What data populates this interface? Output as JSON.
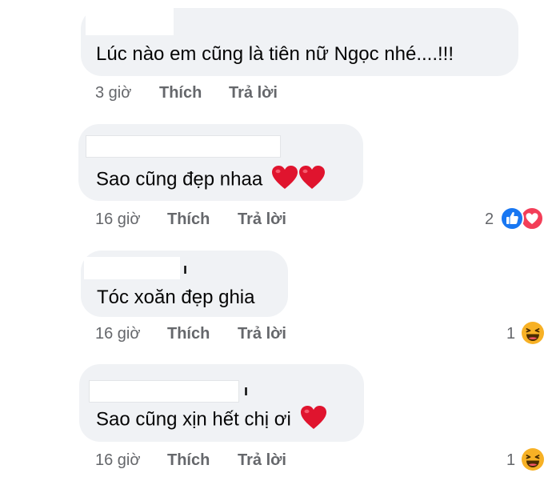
{
  "colors": {
    "bubble": "#f0f2f5",
    "meta_text": "#65676b",
    "text": "#050505",
    "like_blue": "#1877f2",
    "love_red": "#f33e58",
    "haha_yellow": "#f7b125",
    "heart": "#e0142e"
  },
  "comments": [
    {
      "name_fragment": "",
      "text": "Lúc nào em cũng là tiên nữ Ngọc nhé....!!!",
      "hearts": 0,
      "time": "3 giờ",
      "like_label": "Thích",
      "reply_label": "Trả lời",
      "reaction_count": "",
      "reactions": []
    },
    {
      "name_fragment": "",
      "text": "Sao cũng đẹp nhaa",
      "hearts": 2,
      "time": "16 giờ",
      "like_label": "Thích",
      "reply_label": "Trả lời",
      "reaction_count": "2",
      "reactions": [
        "like-icon",
        "love-icon"
      ]
    },
    {
      "name_fragment": "ı",
      "text": "Tóc xoăn đẹp ghia",
      "hearts": 0,
      "time": "16 giờ",
      "like_label": "Thích",
      "reply_label": "Trả lời",
      "reaction_count": "1",
      "reactions": [
        "haha-icon"
      ]
    },
    {
      "name_fragment": "ı",
      "text": "Sao cũng xịn hết chị ơi",
      "hearts": 1,
      "time": "16 giờ",
      "like_label": "Thích",
      "reply_label": "Trả lời",
      "reaction_count": "1",
      "reactions": [
        "haha-icon"
      ]
    }
  ]
}
